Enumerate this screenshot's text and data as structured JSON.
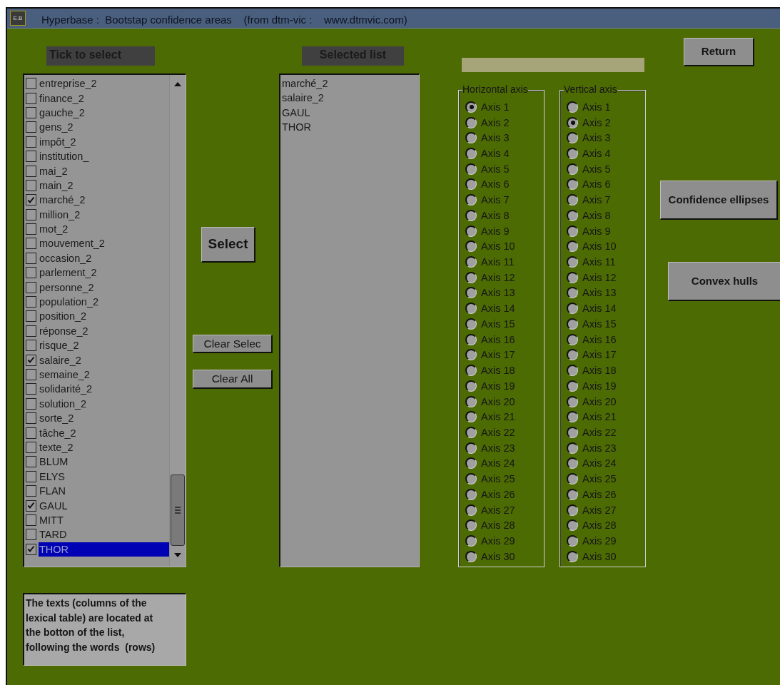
{
  "window": {
    "icon_text": "E.B",
    "title": "Hyperbase :  Bootstap confidence areas    (from dtm-vic :    www.dtmvic.com)"
  },
  "tick_list": {
    "header": "Tick to select",
    "items": [
      {
        "label": "entreprise_2",
        "checked": false,
        "selected": false
      },
      {
        "label": "finance_2",
        "checked": false,
        "selected": false
      },
      {
        "label": "gauche_2",
        "checked": false,
        "selected": false
      },
      {
        "label": "gens_2",
        "checked": false,
        "selected": false
      },
      {
        "label": "impôt_2",
        "checked": false,
        "selected": false
      },
      {
        "label": "institution_",
        "checked": false,
        "selected": false
      },
      {
        "label": "mai_2",
        "checked": false,
        "selected": false
      },
      {
        "label": "main_2",
        "checked": false,
        "selected": false
      },
      {
        "label": "marché_2",
        "checked": true,
        "selected": false
      },
      {
        "label": "million_2",
        "checked": false,
        "selected": false
      },
      {
        "label": "mot_2",
        "checked": false,
        "selected": false
      },
      {
        "label": "mouvement_2",
        "checked": false,
        "selected": false
      },
      {
        "label": "occasion_2",
        "checked": false,
        "selected": false
      },
      {
        "label": "parlement_2",
        "checked": false,
        "selected": false
      },
      {
        "label": "personne_2",
        "checked": false,
        "selected": false
      },
      {
        "label": "population_2",
        "checked": false,
        "selected": false
      },
      {
        "label": "position_2",
        "checked": false,
        "selected": false
      },
      {
        "label": "réponse_2",
        "checked": false,
        "selected": false
      },
      {
        "label": "risque_2",
        "checked": false,
        "selected": false
      },
      {
        "label": "salaire_2",
        "checked": true,
        "selected": false
      },
      {
        "label": "semaine_2",
        "checked": false,
        "selected": false
      },
      {
        "label": "solidarité_2",
        "checked": false,
        "selected": false
      },
      {
        "label": "solution_2",
        "checked": false,
        "selected": false
      },
      {
        "label": "sorte_2",
        "checked": false,
        "selected": false
      },
      {
        "label": "tâche_2",
        "checked": false,
        "selected": false
      },
      {
        "label": "texte_2",
        "checked": false,
        "selected": false
      },
      {
        "label": "BLUM",
        "checked": false,
        "selected": false
      },
      {
        "label": "ELYS",
        "checked": false,
        "selected": false
      },
      {
        "label": "FLAN",
        "checked": false,
        "selected": false
      },
      {
        "label": "GAUL",
        "checked": true,
        "selected": false
      },
      {
        "label": "MITT",
        "checked": false,
        "selected": false
      },
      {
        "label": "TARD",
        "checked": false,
        "selected": false
      },
      {
        "label": "THOR",
        "checked": true,
        "selected": true
      }
    ]
  },
  "selected_list": {
    "header": "Selected list",
    "items": [
      "marché_2",
      "salaire_2",
      "GAUL",
      "THOR"
    ]
  },
  "buttons": {
    "select": "Select",
    "clear_selec": "Clear Selec",
    "clear_all": "Clear All",
    "return": "Return",
    "confidence_ellipses": "Confidence ellipses",
    "convex_hulls": "Convex hulls"
  },
  "info_text": "The texts (columns of the lexical table) are located at the botton of the list, following the words  (rows)",
  "axis_groups": [
    {
      "title": "Horizontal axis",
      "options": [
        {
          "label": "Axis 1",
          "selected": true
        },
        {
          "label": "Axis 2",
          "selected": false
        },
        {
          "label": "Axis 3",
          "selected": false
        },
        {
          "label": "Axis 4",
          "selected": false
        },
        {
          "label": "Axis 5",
          "selected": false
        },
        {
          "label": "Axis 6",
          "selected": false
        },
        {
          "label": "Axis 7",
          "selected": false
        },
        {
          "label": "Axis 8",
          "selected": false
        },
        {
          "label": "Axis 9",
          "selected": false
        },
        {
          "label": "Axis 10",
          "selected": false
        },
        {
          "label": "Axis 11",
          "selected": false
        },
        {
          "label": "Axis 12",
          "selected": false
        },
        {
          "label": "Axis 13",
          "selected": false
        },
        {
          "label": "Axis 14",
          "selected": false
        },
        {
          "label": "Axis 15",
          "selected": false
        },
        {
          "label": "Axis 16",
          "selected": false
        },
        {
          "label": "Axis 17",
          "selected": false
        },
        {
          "label": "Axis 18",
          "selected": false
        },
        {
          "label": "Axis 19",
          "selected": false
        },
        {
          "label": "Axis 20",
          "selected": false
        },
        {
          "label": "Axis 21",
          "selected": false
        },
        {
          "label": "Axis 22",
          "selected": false
        },
        {
          "label": "Axis 23",
          "selected": false
        },
        {
          "label": "Axis 24",
          "selected": false
        },
        {
          "label": "Axis 25",
          "selected": false
        },
        {
          "label": "Axis 26",
          "selected": false
        },
        {
          "label": "Axis 27",
          "selected": false
        },
        {
          "label": "Axis 28",
          "selected": false
        },
        {
          "label": "Axis 29",
          "selected": false
        },
        {
          "label": "Axis 30",
          "selected": false
        }
      ]
    },
    {
      "title": "Vertical axis",
      "options": [
        {
          "label": "Axis 1",
          "selected": false
        },
        {
          "label": "Axis 2",
          "selected": true
        },
        {
          "label": "Axis 3",
          "selected": false
        },
        {
          "label": "Axis 4",
          "selected": false
        },
        {
          "label": "Axis 5",
          "selected": false
        },
        {
          "label": "Axis 6",
          "selected": false
        },
        {
          "label": "Axis 7",
          "selected": false
        },
        {
          "label": "Axis 8",
          "selected": false
        },
        {
          "label": "Axis 9",
          "selected": false
        },
        {
          "label": "Axis 10",
          "selected": false
        },
        {
          "label": "Axis 11",
          "selected": false
        },
        {
          "label": "Axis 12",
          "selected": false
        },
        {
          "label": "Axis 13",
          "selected": false
        },
        {
          "label": "Axis 14",
          "selected": false
        },
        {
          "label": "Axis 15",
          "selected": false
        },
        {
          "label": "Axis 16",
          "selected": false
        },
        {
          "label": "Axis 17",
          "selected": false
        },
        {
          "label": "Axis 18",
          "selected": false
        },
        {
          "label": "Axis 19",
          "selected": false
        },
        {
          "label": "Axis 20",
          "selected": false
        },
        {
          "label": "Axis 21",
          "selected": false
        },
        {
          "label": "Axis 22",
          "selected": false
        },
        {
          "label": "Axis 23",
          "selected": false
        },
        {
          "label": "Axis 24",
          "selected": false
        },
        {
          "label": "Axis 25",
          "selected": false
        },
        {
          "label": "Axis 26",
          "selected": false
        },
        {
          "label": "Axis 27",
          "selected": false
        },
        {
          "label": "Axis 28",
          "selected": false
        },
        {
          "label": "Axis 29",
          "selected": false
        },
        {
          "label": "Axis 30",
          "selected": false
        }
      ]
    }
  ]
}
